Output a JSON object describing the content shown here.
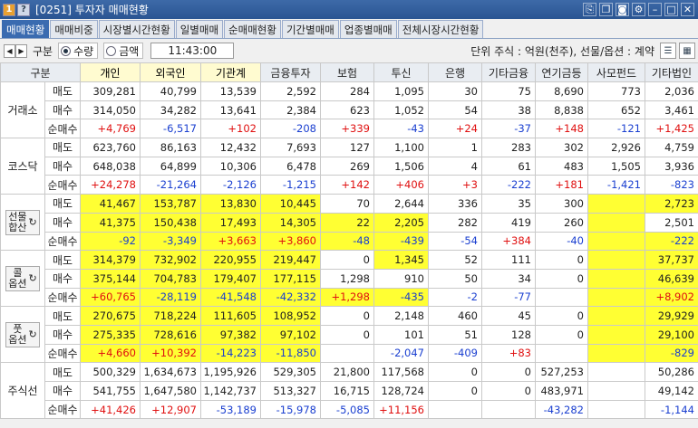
{
  "window": {
    "title": "[0251] 투자자 매매현황",
    "num_badge": "1",
    "help_badge": "?"
  },
  "tabs": [
    {
      "label": "매매현황",
      "active": true
    },
    {
      "label": "매매비중"
    },
    {
      "label": "시장별시간현황"
    },
    {
      "label": "일별매매"
    },
    {
      "label": "순매매현황"
    },
    {
      "label": "기간별매매"
    },
    {
      "label": "업종별매매"
    },
    {
      "label": "전체시장시간현황"
    }
  ],
  "toolbar": {
    "gubun_label": "구분",
    "radio_qty": "수량",
    "radio_amt": "금액",
    "time": "11:43:00",
    "unit_info": "단위 주식 : 억원(천주), 선물/옵션 : 계약"
  },
  "columns": [
    "구분",
    "개인",
    "외국인",
    "기관계",
    "금융투자",
    "보험",
    "투신",
    "은행",
    "기타금융",
    "연기금등",
    "사모펀드",
    "기타법인"
  ],
  "groups": [
    {
      "name": "거래소",
      "button": false,
      "rows": [
        {
          "sub": "매도",
          "vals": [
            "309,281",
            "40,799",
            "13,539",
            "2,592",
            "284",
            "1,095",
            "30",
            "75",
            "8,690",
            "773",
            "2,036"
          ],
          "hl": []
        },
        {
          "sub": "매수",
          "vals": [
            "314,050",
            "34,282",
            "13,641",
            "2,384",
            "623",
            "1,052",
            "54",
            "38",
            "8,838",
            "652",
            "3,461"
          ],
          "hl": []
        },
        {
          "sub": "순매수",
          "vals": [
            "+4,769",
            "-6,517",
            "+102",
            "-208",
            "+339",
            "-43",
            "+24",
            "-37",
            "+148",
            "-121",
            "+1,425"
          ],
          "hl": []
        }
      ]
    },
    {
      "name": "코스닥",
      "button": false,
      "rows": [
        {
          "sub": "매도",
          "vals": [
            "623,760",
            "86,163",
            "12,432",
            "7,693",
            "127",
            "1,100",
            "1",
            "283",
            "302",
            "2,926",
            "4,759"
          ],
          "hl": []
        },
        {
          "sub": "매수",
          "vals": [
            "648,038",
            "64,899",
            "10,306",
            "6,478",
            "269",
            "1,506",
            "4",
            "61",
            "483",
            "1,505",
            "3,936"
          ],
          "hl": []
        },
        {
          "sub": "순매수",
          "vals": [
            "+24,278",
            "-21,264",
            "-2,126",
            "-1,215",
            "+142",
            "+406",
            "+3",
            "-222",
            "+181",
            "-1,421",
            "-823"
          ],
          "hl": []
        }
      ]
    },
    {
      "name": "선물\n합산",
      "button": true,
      "rows": [
        {
          "sub": "매도",
          "vals": [
            "41,467",
            "153,787",
            "13,830",
            "10,445",
            "70",
            "2,644",
            "336",
            "35",
            "300",
            "",
            "2,723"
          ],
          "hl": [
            0,
            1,
            2,
            3,
            9,
            10
          ]
        },
        {
          "sub": "매수",
          "vals": [
            "41,375",
            "150,438",
            "17,493",
            "14,305",
            "22",
            "2,205",
            "282",
            "419",
            "260",
            "",
            "2,501"
          ],
          "hl": [
            0,
            1,
            2,
            3,
            4,
            5,
            9
          ]
        },
        {
          "sub": "순매수",
          "vals": [
            "-92",
            "-3,349",
            "+3,663",
            "+3,860",
            "-48",
            "-439",
            "-54",
            "+384",
            "-40",
            "",
            "-222"
          ],
          "hl": [
            0,
            1,
            2,
            3,
            4,
            5,
            9,
            10
          ]
        }
      ]
    },
    {
      "name": "콜\n옵션",
      "button": true,
      "rows": [
        {
          "sub": "매도",
          "vals": [
            "314,379",
            "732,902",
            "220,955",
            "219,447",
            "0",
            "1,345",
            "52",
            "111",
            "0",
            "",
            "37,737"
          ],
          "hl": [
            0,
            1,
            2,
            3,
            5,
            9,
            10
          ]
        },
        {
          "sub": "매수",
          "vals": [
            "375,144",
            "704,783",
            "179,407",
            "177,115",
            "1,298",
            "910",
            "50",
            "34",
            "0",
            "",
            "46,639"
          ],
          "hl": [
            0,
            1,
            2,
            3,
            9,
            10
          ]
        },
        {
          "sub": "순매수",
          "vals": [
            "+60,765",
            "-28,119",
            "-41,548",
            "-42,332",
            "+1,298",
            "-435",
            "-2",
            "-77",
            "",
            "",
            "+8,902"
          ],
          "hl": [
            0,
            1,
            2,
            3,
            4,
            5,
            9,
            10
          ]
        }
      ]
    },
    {
      "name": "풋\n옵션",
      "button": true,
      "rows": [
        {
          "sub": "매도",
          "vals": [
            "270,675",
            "718,224",
            "111,605",
            "108,952",
            "0",
            "2,148",
            "460",
            "45",
            "0",
            "",
            "29,929"
          ],
          "hl": [
            0,
            1,
            2,
            3,
            9,
            10
          ]
        },
        {
          "sub": "매수",
          "vals": [
            "275,335",
            "728,616",
            "97,382",
            "97,102",
            "0",
            "101",
            "51",
            "128",
            "0",
            "",
            "29,100"
          ],
          "hl": [
            0,
            1,
            2,
            3,
            9,
            10
          ]
        },
        {
          "sub": "순매수",
          "vals": [
            "+4,660",
            "+10,392",
            "-14,223",
            "-11,850",
            "",
            "-2,047",
            "-409",
            "+83",
            "",
            "",
            "-829"
          ],
          "hl": [
            0,
            1,
            2,
            3,
            9,
            10
          ]
        }
      ]
    },
    {
      "name": "주식선",
      "button": false,
      "rows": [
        {
          "sub": "매도",
          "vals": [
            "500,329",
            "1,634,673",
            "1,195,926",
            "529,305",
            "21,800",
            "117,568",
            "0",
            "0",
            "527,253",
            "",
            "50,286"
          ],
          "hl": []
        },
        {
          "sub": "매수",
          "vals": [
            "541,755",
            "1,647,580",
            "1,142,737",
            "513,327",
            "16,715",
            "128,724",
            "0",
            "0",
            "483,971",
            "",
            "49,142"
          ],
          "hl": []
        },
        {
          "sub": "순매수",
          "vals": [
            "+41,426",
            "+12,907",
            "-53,189",
            "-15,978",
            "-5,085",
            "+11,156",
            "",
            "",
            "-43,282",
            "",
            "-1,144"
          ],
          "hl": []
        }
      ]
    }
  ]
}
